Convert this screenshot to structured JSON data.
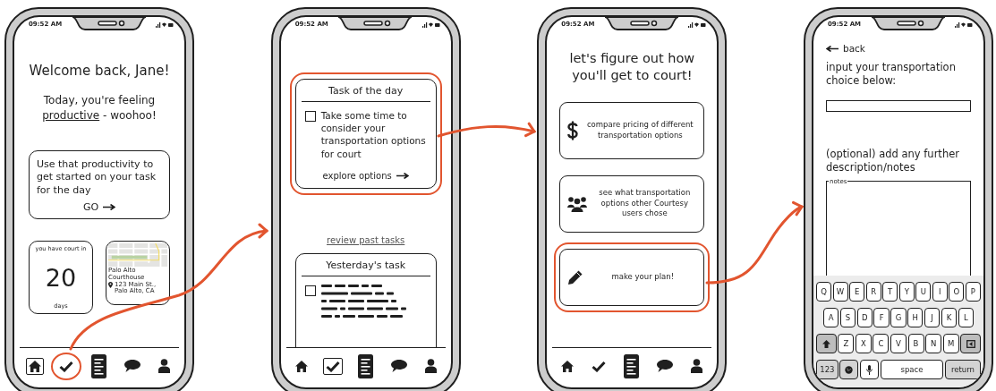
{
  "phones": [
    {
      "kind": "home",
      "status_time": "09:52 AM",
      "greeting": "Welcome back, Jane!",
      "mood": {
        "before": "Today, you're feeling",
        "word": "productive",
        "after": "- woohoo!"
      },
      "prompt_card": {
        "text": "Use that productivity to get started on your task for the day",
        "action": "GO"
      },
      "countdown": {
        "label": "you have court in",
        "number": "20",
        "unit": "days"
      },
      "location": {
        "name": "Palo Alto Courthouse",
        "address_lines": [
          "123 Main St.,",
          "Palo Alto, CA"
        ]
      },
      "nav": [
        {
          "kind": "home",
          "selected": true,
          "highlighted": false
        },
        {
          "kind": "tasks",
          "selected": false,
          "highlighted": true
        },
        {
          "kind": "document",
          "selected": false,
          "highlighted": false
        },
        {
          "kind": "chat",
          "selected": false,
          "highlighted": false
        },
        {
          "kind": "profile",
          "selected": false,
          "highlighted": false
        }
      ]
    },
    {
      "kind": "tasks",
      "status_time": "09:52 AM",
      "task_card": {
        "title": "Task of the day",
        "checked": false,
        "text": "Take some time to consider your transportation options for court",
        "action": "explore options",
        "highlighted": true
      },
      "review_link": "review past tasks",
      "past_card": {
        "title": "Yesterday's task",
        "checked": false
      },
      "nav": [
        {
          "kind": "home",
          "selected": false,
          "highlighted": false
        },
        {
          "kind": "tasks",
          "selected": true,
          "highlighted": false
        },
        {
          "kind": "document",
          "selected": false,
          "highlighted": false
        },
        {
          "kind": "chat",
          "selected": false,
          "highlighted": false
        },
        {
          "kind": "profile",
          "selected": false,
          "highlighted": false
        }
      ]
    },
    {
      "kind": "options",
      "status_time": "09:52 AM",
      "title": "let's figure out how you'll get to court!",
      "options": [
        {
          "kind": "pricing",
          "text": "compare pricing of different transportation options",
          "highlighted": false
        },
        {
          "kind": "community",
          "text": "see what transportation options other Courtesy users chose",
          "highlighted": false
        },
        {
          "kind": "plan",
          "text": "make your plan!",
          "highlighted": true
        }
      ],
      "nav": [
        {
          "kind": "home",
          "selected": false,
          "highlighted": false
        },
        {
          "kind": "tasks",
          "selected": false,
          "highlighted": false
        },
        {
          "kind": "document",
          "selected": false,
          "highlighted": false
        },
        {
          "kind": "chat",
          "selected": false,
          "highlighted": false
        },
        {
          "kind": "profile",
          "selected": false,
          "highlighted": false
        }
      ]
    },
    {
      "kind": "form",
      "status_time": "09:52 AM",
      "back": "back",
      "choice_prompt": "input your transportation choice below:",
      "notes_prompt": "(optional) add any further description/notes",
      "notes_label": "notes",
      "keyboard": [
        [
          {
            "kind": "letter",
            "label": "Q"
          },
          {
            "kind": "letter",
            "label": "W"
          },
          {
            "kind": "letter",
            "label": "E"
          },
          {
            "kind": "letter",
            "label": "R"
          },
          {
            "kind": "letter",
            "label": "T"
          },
          {
            "kind": "letter",
            "label": "Y"
          },
          {
            "kind": "letter",
            "label": "U"
          },
          {
            "kind": "letter",
            "label": "I"
          },
          {
            "kind": "letter",
            "label": "O"
          },
          {
            "kind": "letter",
            "label": "P"
          }
        ],
        [
          {
            "kind": "letter",
            "label": "A"
          },
          {
            "kind": "letter",
            "label": "S"
          },
          {
            "kind": "letter",
            "label": "D"
          },
          {
            "kind": "letter",
            "label": "F"
          },
          {
            "kind": "letter",
            "label": "G"
          },
          {
            "kind": "letter",
            "label": "H"
          },
          {
            "kind": "letter",
            "label": "J"
          },
          {
            "kind": "letter",
            "label": "K"
          },
          {
            "kind": "letter",
            "label": "L"
          }
        ],
        [
          {
            "kind": "shift"
          },
          {
            "kind": "letter",
            "label": "Z"
          },
          {
            "kind": "letter",
            "label": "X"
          },
          {
            "kind": "letter",
            "label": "C"
          },
          {
            "kind": "letter",
            "label": "V"
          },
          {
            "kind": "letter",
            "label": "B"
          },
          {
            "kind": "letter",
            "label": "N"
          },
          {
            "kind": "letter",
            "label": "M"
          },
          {
            "kind": "delete"
          }
        ],
        [
          {
            "kind": "mode",
            "label": "123"
          },
          {
            "kind": "globe"
          },
          {
            "kind": "mic"
          },
          {
            "kind": "space",
            "label": "space"
          },
          {
            "kind": "return",
            "label": "return"
          }
        ]
      ]
    }
  ]
}
